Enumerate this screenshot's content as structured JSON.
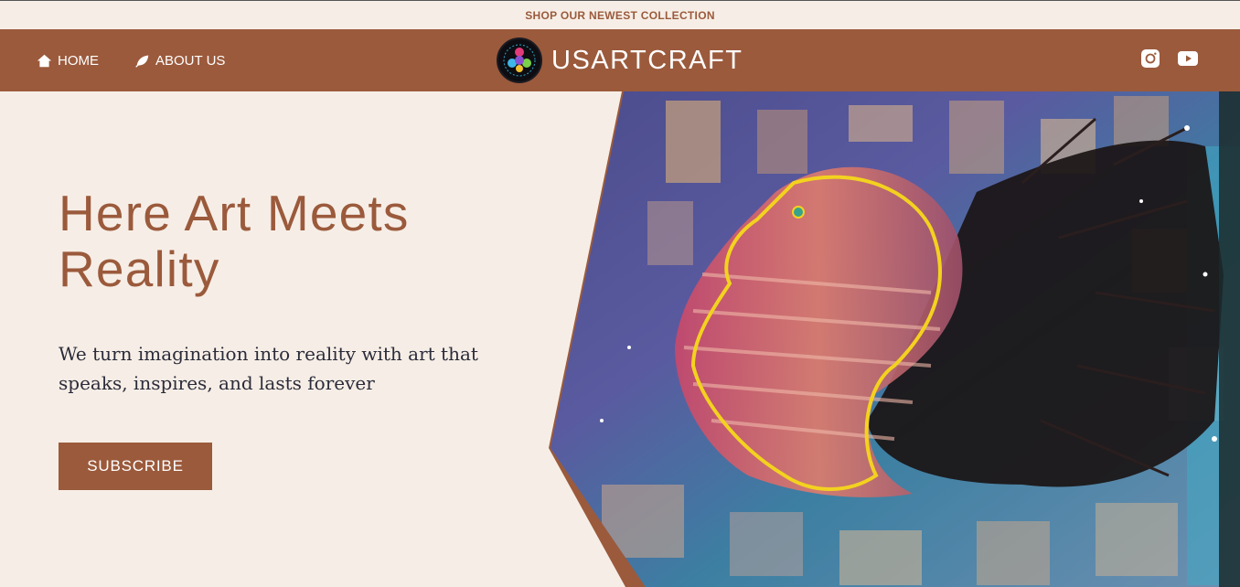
{
  "announcement": {
    "text": "SHOP OUR NEWEST COLLECTION"
  },
  "header": {
    "brand": "USARTCRAFT",
    "nav": [
      {
        "label": "HOME",
        "icon": "home-icon"
      },
      {
        "label": "ABOUT US",
        "icon": "leaf-icon"
      }
    ],
    "social": [
      {
        "icon": "instagram-icon"
      },
      {
        "icon": "youtube-icon"
      }
    ]
  },
  "hero": {
    "title": "Here Art Meets Reality",
    "subtitle": "We turn imagination into reality with art that speaks, inspires, and lasts forever",
    "cta_label": "SUBSCRIBE"
  },
  "colors": {
    "accent": "#9b5a3c",
    "background": "#f6eee6",
    "text_dark": "#2b2b3a"
  }
}
